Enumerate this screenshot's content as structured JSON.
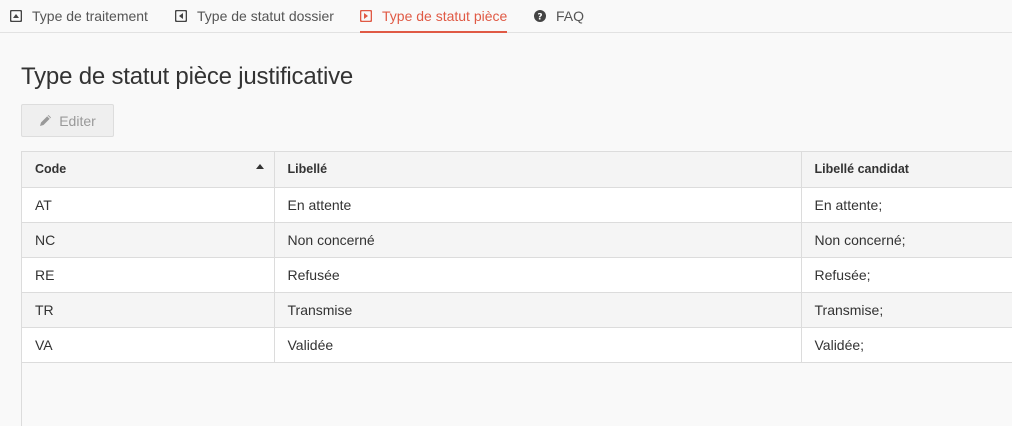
{
  "tabs": [
    {
      "label": "Type de traitement",
      "icon": "caret-square-up-icon",
      "active": false
    },
    {
      "label": "Type de statut dossier",
      "icon": "caret-square-left-icon",
      "active": false
    },
    {
      "label": "Type de statut pièce",
      "icon": "caret-square-right-icon",
      "active": true
    },
    {
      "label": "FAQ",
      "icon": "question-circle-icon",
      "active": false
    }
  ],
  "page": {
    "title": "Type de statut pièce justificative",
    "edit_label": "Editer"
  },
  "table": {
    "columns": [
      "Code",
      "Libellé",
      "Libellé candidat"
    ],
    "sort": {
      "column": "Code",
      "direction": "ascending"
    },
    "rows": [
      [
        "AT",
        "En attente",
        "En attente;"
      ],
      [
        "NC",
        "Non concerné",
        "Non concerné;"
      ],
      [
        "RE",
        "Refusée",
        "Refusée;"
      ],
      [
        "TR",
        "Transmise",
        "Transmise;"
      ],
      [
        "VA",
        "Validée",
        "Validée;"
      ]
    ]
  },
  "colors": {
    "accent": "#e05a45",
    "text": "#333333",
    "muted": "#999999"
  }
}
